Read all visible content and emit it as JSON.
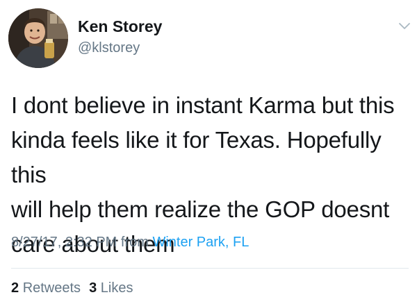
{
  "author": {
    "display_name": "Ken Storey",
    "handle": "@klstorey"
  },
  "tweet": {
    "text": "I dont believe in instant Karma but this\nkinda feels like it for Texas. Hopefully this\nwill help them realize the GOP doesnt\ncare about them",
    "timestamp": "8/27/17, 2:32 PM",
    "from_label": "from",
    "location": "Winter Park, FL"
  },
  "stats": {
    "retweets_count": "2",
    "retweets_label": "Retweets",
    "likes_count": "3",
    "likes_label": "Likes"
  },
  "icons": {
    "menu": "chevron-down-icon"
  },
  "colors": {
    "text": "#14171a",
    "secondary": "#657786",
    "link": "#1da1f2",
    "divider": "#e1e8ed"
  }
}
